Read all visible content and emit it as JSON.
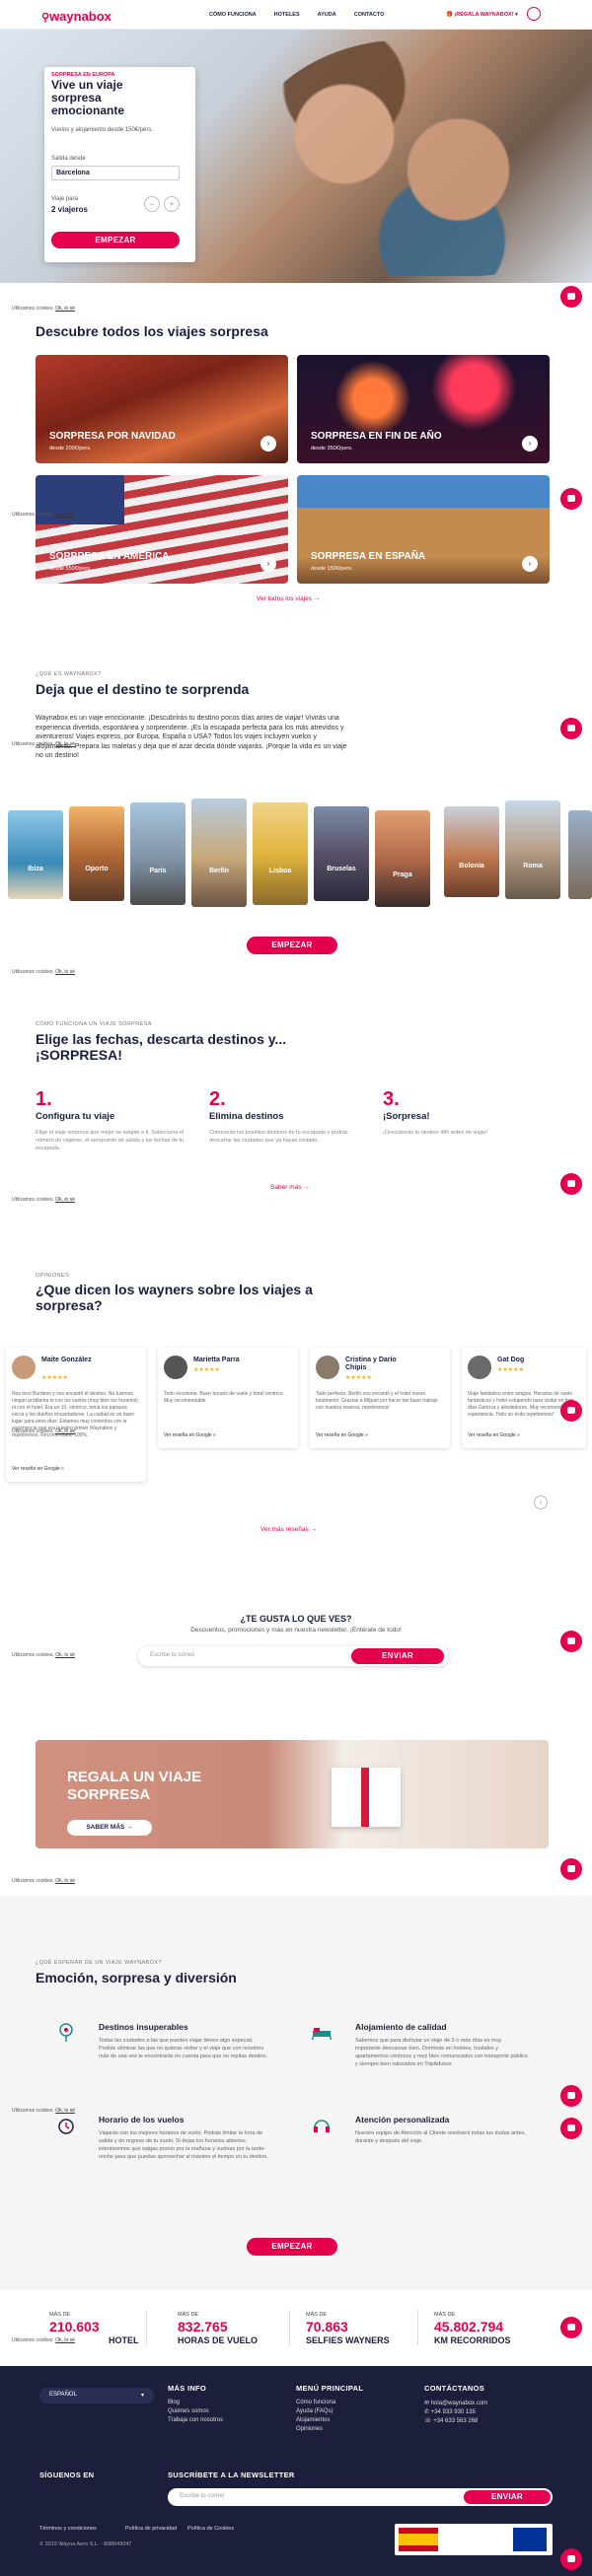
{
  "header": {
    "logo": "waynabox",
    "nav": [
      "CÓMO FUNCIONA",
      "HOTELES",
      "AYUDA",
      "CONTACTO"
    ],
    "gift": "¡REGALA WAYNABOX!",
    "gift_arrow": "▾"
  },
  "hero": {
    "eyebrow": "SORPRESA EN EUROPA",
    "title": "Vive un viaje sorpresa emocionante",
    "subtitle": "Vuelos y alojamiento desde 150€/pers.",
    "origin_label": "Salida desde",
    "origin_value": "Barcelona",
    "travelers_label": "Viaje para",
    "travelers_value": "2 viajeros",
    "minus": "−",
    "plus": "+",
    "cta": "EMPEZAR"
  },
  "cookie": {
    "text": "Utilizamos cookies.",
    "link": "Ok, lo sé"
  },
  "trips": {
    "title": "Descubre todos los viajes sorpresa",
    "items": [
      {
        "title": "SORPRESA POR NAVIDAD",
        "price": "desde 200€/pers."
      },
      {
        "title": "SORPRESA EN FIN DE AÑO",
        "price": "desde 350€/pers."
      },
      {
        "title": "SORPRESA EN AMÉRICA",
        "price": "desde 550€/pers."
      },
      {
        "title": "SORPRESA EN ESPAÑA",
        "price": "desde 150€/pers."
      }
    ],
    "arrow": "›",
    "see_all": "Ver todos los viajes →"
  },
  "about": {
    "eyebrow": "¿QUÉ ES WAYNABOX?",
    "title": "Deja que el destino te sorprenda",
    "text": "Waynabox es un viaje emocionante. ¡Descubrirás tu destino pocos días antes de viajar! Vivirás una experiencia divertida, espontánea y sorprendente. ¡Es la escapada perfecta para los más atrevidos y aventureros! Viajes express, por Europa, España o USA? Todos los viajes incluyen vuelos y alojamiento. Prepara las maletas y deja que el azar decida dónde viajarás. ¡Porque la vida es un viaje no un destino!",
    "cities": [
      "Ibiza",
      "Oporto",
      "París",
      "Berlín",
      "Lisboa",
      "Bruselas",
      "Praga",
      "Bolonia",
      "Roma"
    ],
    "cta": "EMPEZAR"
  },
  "how": {
    "eyebrow": "CÓMO FUNCIONA UN VIAJE SORPRESA",
    "title": "Elige las fechas, descarta destinos y... ¡SORPRESA!",
    "steps": [
      {
        "num": "1.",
        "title": "Configura tu viaje",
        "text": "Elige el viaje sorpresa que mejor se adapte a ti. Selecciona el número de viajeros, el aeropuerto de salida y las fechas de tu escapada."
      },
      {
        "num": "2.",
        "title": "Elimina destinos",
        "text": "Conocerás los posibles destinos de tu escapada y podrás descartar las ciudades que ya hayas visitado."
      },
      {
        "num": "3.",
        "title": "¡Sorpresa!",
        "text": "¡Descubrirás tu destino 48h antes de viajar!"
      }
    ],
    "more": "Saber más →"
  },
  "reviews": {
    "eyebrow": "OPINIONES",
    "title": "¿Que dicen los wayners sobre los viajes a sorpresa?",
    "stars": "★★★★★",
    "link": "Ver reseña en Google »",
    "items": [
      {
        "name": "Maite González",
        "text": "Nos tocó Burdeos y nos encantó el destino. No tuvimos ningún problema ni con los vuelos (muy bien los horarios) ni con el hotel. Era un 10, céntrico, tenía los parques cerca y los dueños encantadores. La ciudad es un buen lugar para unos días. Estamos muy contentos con la experiencia que era nuestro primer Waynabox y repetiremos. Recomendado 100%."
      },
      {
        "name": "Marietta Parra",
        "text": "Todo excelente. Buen horario de vuelo y hotel céntrico. Muy recomendable"
      },
      {
        "name": "Cristina y Darío Chipis",
        "text": "Todo perfecto. Berlín nos encantó y el hotel nuevo totalmente. Gracias a Miguel por hacer tan buen trabajo con nuestra reserva, repetiremos!"
      },
      {
        "name": "Gat Dog",
        "text": "Viaje fantástico entre amigos. Horarios de vuelo fantásticos y hotel estupendo para visitar en tres días Génova y alrededores. Muy recomendable la experiencia. Todo un éxito repetiremos!"
      }
    ],
    "next": "›",
    "see_more": "Ver más reseñas →"
  },
  "newsletter": {
    "title": "¿TE GUSTA LO QUE VES?",
    "subtitle": "Descuentos, promociones y más en nuestra newsletter. ¡Entérate de todo!",
    "placeholder": "Escribe tu correo",
    "button": "ENVIAR"
  },
  "gift": {
    "title": "REGALA UN VIAJE SORPRESA",
    "button": "SABER MÁS →"
  },
  "features": {
    "eyebrow": "¿QUÉ ESPERAR DE UN VIAJE WAYNABOX?",
    "title": "Emoción, sorpresa y diversión",
    "items": [
      {
        "title": "Destinos insuperables",
        "text": "Todas las ciudades a las que puedes viajar tienen algo especial. Podrás eliminar las que no quieras visitar y el viaje que con nosotros más de una vez te encontrarás en cuenta para que no repitas destino."
      },
      {
        "title": "Alojamiento de calidad",
        "text": "Sabemos que para disfrutar un viaje de 3 o más días es muy importante descansar bien. Dormirás en hoteles, hostales y apartamentos céntricos y muy bien comunicados con transporte público y siempre bien valorados en TripAdvisor."
      },
      {
        "title": "Horario de los vuelos",
        "text": "Viajarás con los mejores horarios de vuelo. Podrás limitar la hora de salida y de regreso de tu vuelo. Si dejas los horarios abiertos, intentaremos que salgas pronto por la mañana y vuelvas por la tarde-noche para que puedas aprovechar al máximo el tiempo en tu destino."
      },
      {
        "title": "Atención personalizada",
        "text": "Nuestro equipo de Atención al Cliente resolverá todas tus dudas antes, durante y después del viaje."
      }
    ],
    "cta": "EMPEZAR"
  },
  "stats": [
    {
      "label": "MÁS DE",
      "num": "210.603",
      "suffix": "HOTEL"
    },
    {
      "label": "MÁS DE",
      "num": "832.765",
      "suffix": "HORAS DE VUELO"
    },
    {
      "label": "MÁS DE",
      "num": "70.863",
      "suffix": "SELFIES WAYNERS"
    },
    {
      "label": "MÁS DE",
      "num": "45.802.794",
      "suffix": "KM RECORRIDOS"
    }
  ],
  "footer": {
    "lang": "ESPAÑOL",
    "more_title": "MÁS INFO",
    "more": [
      "Blog",
      "Quiénes somos",
      "Trabaja con nosotros"
    ],
    "menu_title": "MENÚ PRINCIPAL",
    "menu": [
      "Cómo funciona",
      "Ayuda (FAQs)",
      "Alojamientos",
      "Opiniones"
    ],
    "contact_title": "CONTÁCTANOS",
    "contact": [
      "hola@waynabox.com",
      "+34 933 930 135",
      "+34 633 563 268"
    ],
    "follow": "SÍGUENOS EN",
    "newsletter_title": "SUSCRÍBETE A LA NEWSLETTER",
    "newsletter_placeholder": "Escribe tu correo",
    "newsletter_button": "ENVIAR",
    "legal": [
      "Términos y condiciones",
      "Política de privacidad",
      "Política de Cookies"
    ],
    "copyright": "© 2019 Wayna Aero S.L. - B98649047"
  },
  "colors": {
    "accent": "#e4004f",
    "navy": "#1c1f3c",
    "footer": "#1c1f3c"
  }
}
